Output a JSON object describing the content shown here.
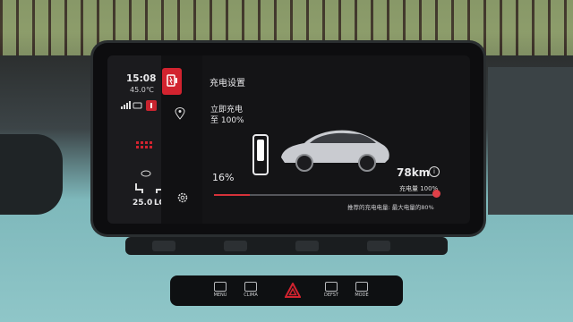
{
  "status": {
    "time": "15:08",
    "outside_temp": "45.0℃"
  },
  "climate": {
    "temp_left": "25.0",
    "temp_right": "LO"
  },
  "charging": {
    "title": "充电设置",
    "mode_line1": "立即充电",
    "mode_line2": "至 100%",
    "current_percent": "16%",
    "current_percent_value": 16,
    "range": "78km",
    "limit_label": "充电量 100%",
    "limit_value": 100,
    "recommendation": "推荐的充电电量: 最大电量的80%"
  },
  "console": {
    "menu_label": "MENU",
    "climate_label": "CLIMA",
    "defrost_label": "DEFST",
    "mode_label": "MODE"
  },
  "colors": {
    "accent": "#d2232f",
    "screen_bg": "#141416",
    "interior_teal": "#8fc6c8"
  }
}
